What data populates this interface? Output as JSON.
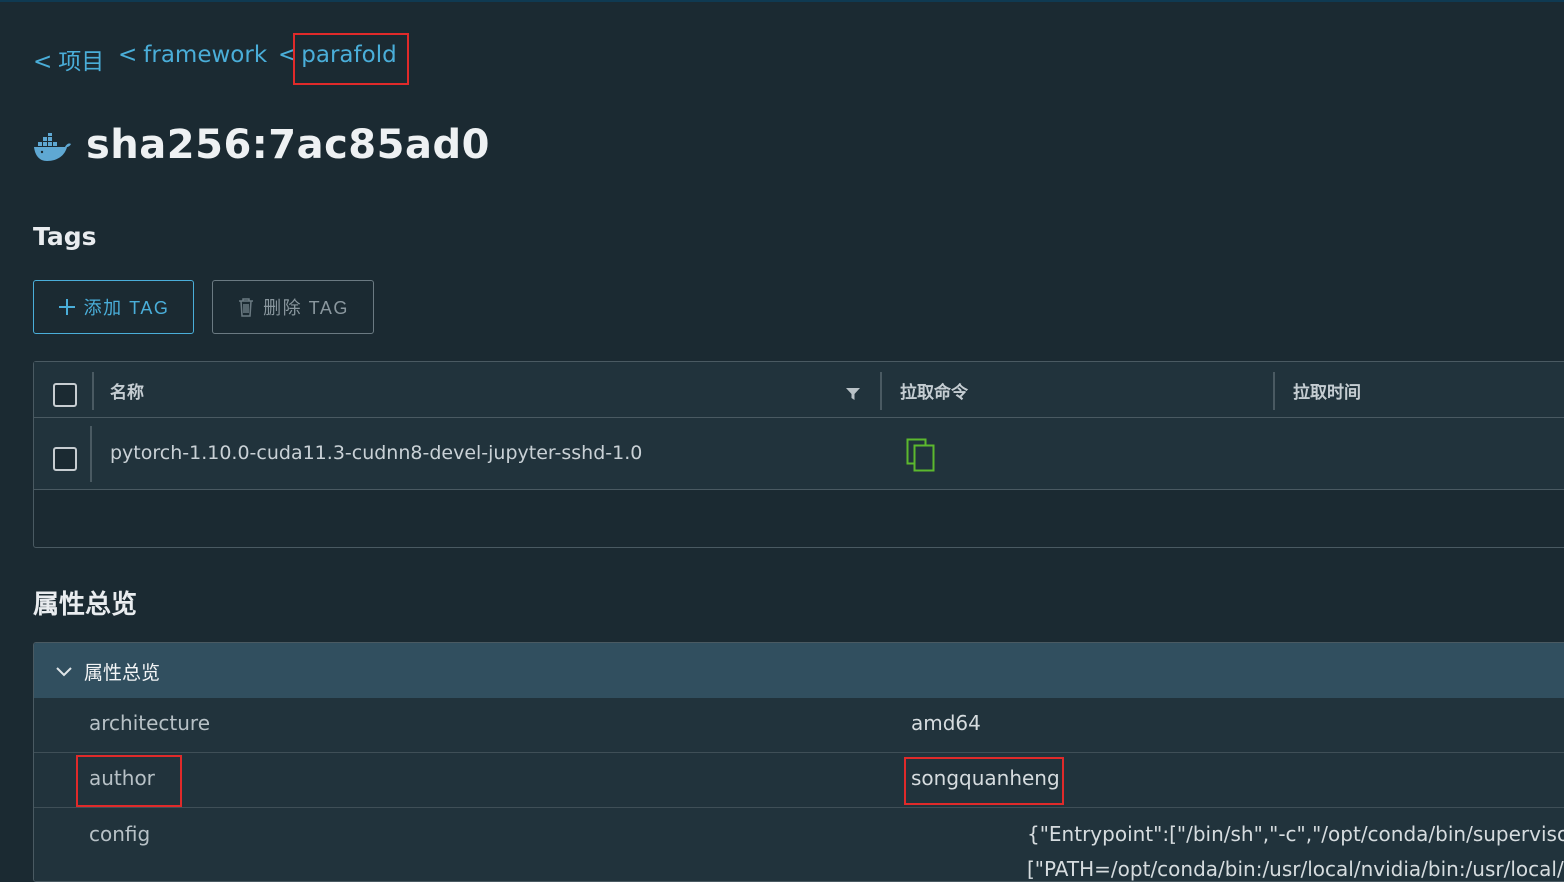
{
  "breadcrumb": {
    "separator": "<",
    "items": [
      "项目",
      "framework",
      "parafold"
    ]
  },
  "page": {
    "title": "sha256:7ac85ad0",
    "icon": "docker-whale-icon"
  },
  "tags_section": {
    "heading": "Tags",
    "add_button": "添加 TAG",
    "delete_button": "删除 TAG"
  },
  "tags_table": {
    "columns": [
      "名称",
      "拉取命令",
      "拉取时间"
    ],
    "rows": [
      {
        "name": "pytorch-1.10.0-cuda11.3-cudnn8-devel-jupyter-sshd-1.0",
        "pull_command_icon": "copy-icon",
        "pull_time": ""
      }
    ]
  },
  "properties_section": {
    "heading": "属性总览",
    "panel_title": "属性总览",
    "rows": [
      {
        "key": "architecture",
        "value": "amd64"
      },
      {
        "key": "author",
        "value": "songquanheng"
      },
      {
        "key": "config",
        "value_line1": "{\"Entrypoint\":[\"/bin/sh\",\"-c\",\"/opt/conda/bin/supervisord -",
        "value_line2": "[\"PATH=/opt/conda/bin:/usr/local/nvidia/bin:/usr/local/cu"
      }
    ]
  },
  "colors": {
    "accent": "#4aaed9",
    "highlight_box": "#e02a2a",
    "background": "#1b2a32",
    "panel_header": "#314f5f",
    "copy_icon": "#5cb82e"
  }
}
